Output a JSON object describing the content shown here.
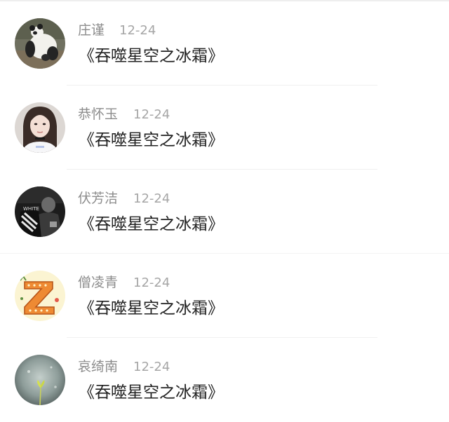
{
  "comments": [
    {
      "user": "庄谨",
      "date": "12-24",
      "text": "《吞噬星空之冰霜》",
      "avatar_icon": "panda-photo-avatar",
      "avatar_colors": [
        "#6b6a5d",
        "#2b2b2b",
        "#f2f2ef"
      ]
    },
    {
      "user": "恭怀玉",
      "date": "12-24",
      "text": "《吞噬星空之冰霜》",
      "avatar_icon": "girl-portrait-avatar",
      "avatar_colors": [
        "#d9d3cf",
        "#3b2e2a",
        "#f4e1d8"
      ]
    },
    {
      "user": "伏芳洁",
      "date": "12-24",
      "text": "《吞噬星空之冰霜》",
      "avatar_icon": "dark-streetwear-avatar",
      "avatar_colors": [
        "#1e1e1e",
        "#8a8a8a",
        "#f0f0f0"
      ]
    },
    {
      "user": "僧凌青",
      "date": "12-24",
      "text": "《吞噬星空之冰霜》",
      "avatar_icon": "letter-z-avatar",
      "avatar_colors": [
        "#fbf3cf",
        "#e8842e",
        "#6a9c4a"
      ]
    },
    {
      "user": "哀绮南",
      "date": "12-24",
      "text": "《吞噬星空之冰霜》",
      "avatar_icon": "plant-sprout-avatar",
      "avatar_colors": [
        "#7d8c8a",
        "#b8c4c0",
        "#d5e04c"
      ]
    }
  ]
}
